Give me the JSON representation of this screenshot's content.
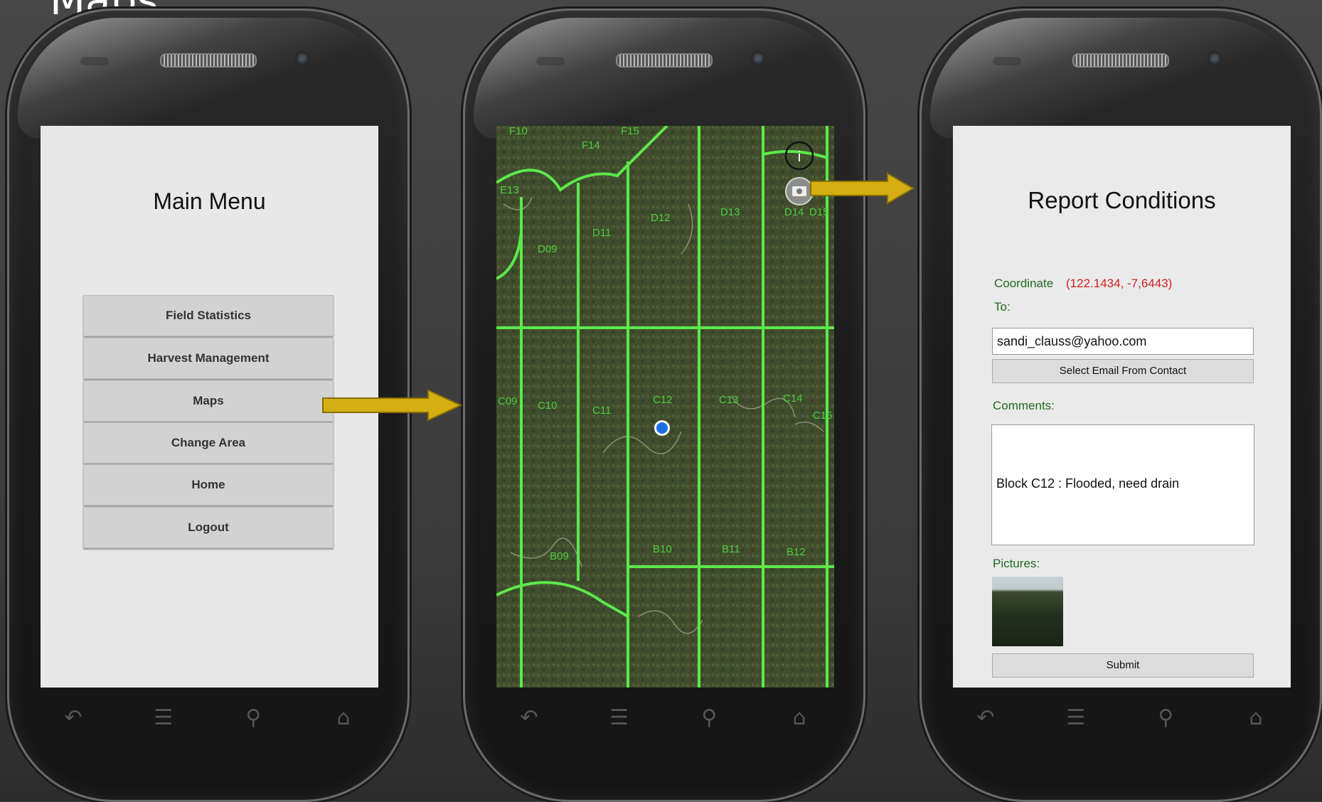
{
  "slide_title": "Maps",
  "colors": {
    "accent_arrow": "#d4ae12",
    "map_green": "#5ce84a",
    "coord_red": "#d12020",
    "label_green": "#1f6b1f"
  },
  "phones": {
    "nav_icons": [
      "back-icon",
      "menu-icon",
      "search-icon",
      "home-icon"
    ]
  },
  "main_menu": {
    "title": "Main Menu",
    "buttons": [
      "Field Statistics",
      "Harvest Management",
      "Maps",
      "Change Area",
      "Home",
      "Logout"
    ]
  },
  "map": {
    "info_icon": "i",
    "camera_icon": "camera-icon",
    "blocks": [
      "F10",
      "F14",
      "F15",
      "E13",
      "D09",
      "D11",
      "D12",
      "D13",
      "D14",
      "D15",
      "C09",
      "C10",
      "C11",
      "C12",
      "C13",
      "C14",
      "C15",
      "B09",
      "B10",
      "B11",
      "B12"
    ]
  },
  "report": {
    "title": "Report Conditions",
    "coordinate_label": "Coordinate",
    "coordinate_value": "(122.1434, -7,6443)",
    "to_label": "To:",
    "email_value": "sandi_clauss@yahoo.com",
    "select_email_label": "Select Email From Contact",
    "comments_label": "Comments:",
    "comments_value": "Block C12 : Flooded, need drain",
    "pictures_label": "Pictures:",
    "submit_label": "Submit"
  }
}
